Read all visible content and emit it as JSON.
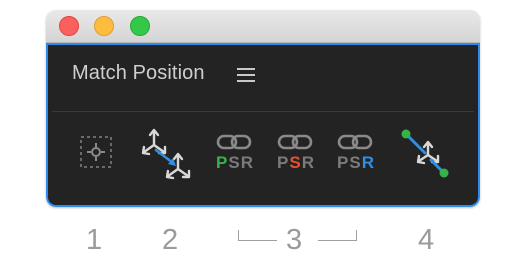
{
  "window": {
    "traffic_lights": {
      "close_color": "#fc605c",
      "minimize_color": "#fdbc40",
      "maximize_color": "#34c84a"
    }
  },
  "panel": {
    "title": "Match Position",
    "menu_icon": "hamburger-menu-icon",
    "border_color": "#2d8ceb",
    "tools": [
      {
        "name": "anchor-point-tool",
        "icon": "anchor-point-icon"
      },
      {
        "name": "move-to-target-tool",
        "icon": "move-transform-icon"
      },
      {
        "name": "match-position-psr",
        "icon": "chain-link-icon",
        "p": "P",
        "s": "S",
        "r": "R",
        "highlight": "P",
        "highlight_color": "#35b34a"
      },
      {
        "name": "match-scale-psr",
        "icon": "chain-link-icon",
        "p": "P",
        "s": "S",
        "r": "R",
        "highlight": "S",
        "highlight_color": "#e8502f"
      },
      {
        "name": "match-rotation-psr",
        "icon": "chain-link-icon",
        "p": "P",
        "s": "S",
        "r": "R",
        "highlight": "R",
        "highlight_color": "#2f8fe0"
      },
      {
        "name": "align-between-tool",
        "icon": "connect-points-icon"
      }
    ]
  },
  "labels": {
    "one": "1",
    "two": "2",
    "three": "3",
    "four": "4"
  }
}
